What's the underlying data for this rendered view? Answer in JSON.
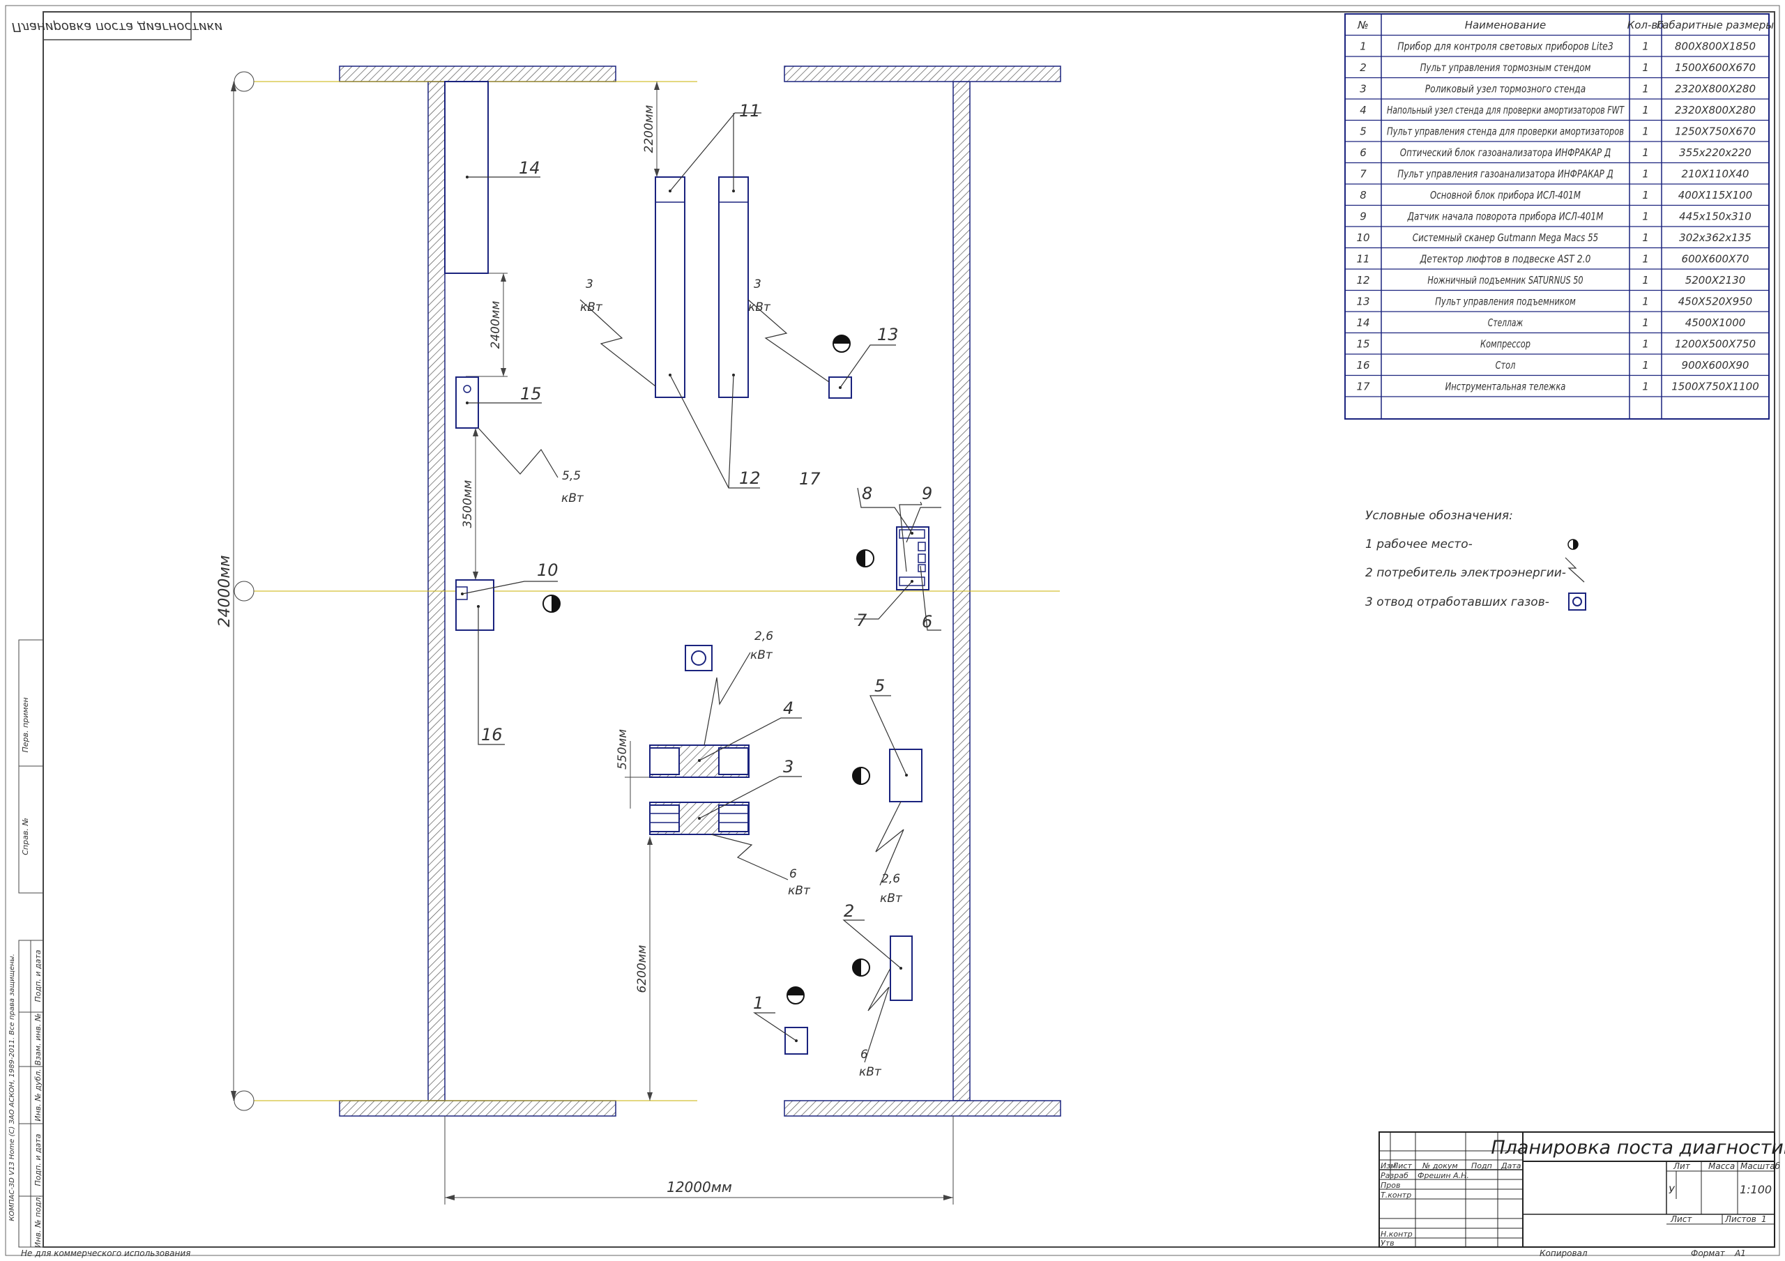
{
  "stamp": {
    "mirrored_title": "Планировка поста диагностики"
  },
  "dimensions": {
    "total_length": "24000мм",
    "width": "12000мм",
    "d_2200": "2200мм",
    "d_2400": "2400мм",
    "d_3500": "3500мм",
    "d_550": "550мм",
    "d_6200": "6200мм"
  },
  "callouts": [
    "1",
    "2",
    "3",
    "4",
    "5",
    "6",
    "7",
    "8",
    "9",
    "10",
    "11",
    "12",
    "13",
    "14",
    "15",
    "16",
    "17"
  ],
  "power_labels": {
    "p1": {
      "value": "3",
      "unit": "кВт"
    },
    "p2": {
      "value": "3",
      "unit": "кВт"
    },
    "p3": {
      "value": "5,5",
      "unit": "кВт"
    },
    "p4": {
      "value": "2,6",
      "unit": "кВт"
    },
    "p5": {
      "value": "6",
      "unit": "кВт"
    },
    "p6": {
      "value": "2,6",
      "unit": "кВт"
    },
    "p7": {
      "value": "6",
      "unit": "кВт"
    }
  },
  "spec_table": {
    "headers": [
      "№",
      "Наименование",
      "Кол-во",
      "Габаритные размеры"
    ],
    "rows": [
      [
        "1",
        "Прибор для контроля световых приборов Lite3",
        "1",
        "800Х800Х1850"
      ],
      [
        "2",
        "Пульт управления тормозным стендом",
        "1",
        "1500Х600Х670"
      ],
      [
        "3",
        "Роликовый узел тормозного стенда",
        "1",
        "2320Х800Х280"
      ],
      [
        "4",
        "Напольный узел стенда для проверки амортизаторов FWT",
        "1",
        "2320Х800Х280"
      ],
      [
        "5",
        "Пульт управления стенда для проверки амортизаторов",
        "1",
        "1250Х750Х670"
      ],
      [
        "6",
        "Оптический блок газоанализатора ИНФРАКАР Д",
        "1",
        "355х220х220"
      ],
      [
        "7",
        "Пульт управления газоанализатора ИНФРАКАР Д",
        "1",
        "210Х110Х40"
      ],
      [
        "8",
        "Основной блок прибора ИСЛ-401М",
        "1",
        "400Х115Х100"
      ],
      [
        "9",
        "Датчик начала поворота прибора ИСЛ-401М",
        "1",
        "445х150х310"
      ],
      [
        "10",
        "Системный сканер Gutmann Mega Macs 55",
        "1",
        "302х362х135"
      ],
      [
        "11",
        "Детектор люфтов в подвеске AST 2.0",
        "1",
        "600Х600Х70"
      ],
      [
        "12",
        "Ножничный подъемник SATURNUS 50",
        "1",
        "5200Х2130"
      ],
      [
        "13",
        "Пульт управления подъемником",
        "1",
        "450Х520Х950"
      ],
      [
        "14",
        "Стеллаж",
        "1",
        "4500Х1000"
      ],
      [
        "15",
        "Компрессор",
        "1",
        "1200Х500Х750"
      ],
      [
        "16",
        "Стол",
        "1",
        "900Х600Х90"
      ],
      [
        "17",
        "Инструментальная тележка",
        "1",
        "1500Х750Х1100"
      ]
    ]
  },
  "legend": {
    "title": "Условные обозначения:",
    "item1": "1 рабочее место-",
    "item2": "2 потребитель электроэнергии-",
    "item3": "3 отвод отработавших газов-"
  },
  "title_block": {
    "drawing_title": "Планировка поста диагностики",
    "col_izm": "Изм",
    "col_list": "Лист",
    "col_doc": "№ докум",
    "col_podp": "Подп",
    "col_data": "Дата",
    "row_razrab": "Разраб",
    "razrab_name": "Фрешин А.Н.",
    "row_prov": "Пров",
    "row_tkontr": "Т.контр",
    "row_nkontr": "Н.контр",
    "row_utv": "Утв",
    "lit_label": "Лит",
    "mass_label": "Масса",
    "scale_label": "Масштаб",
    "lit_value": "У",
    "scale_value": "1:100",
    "sheet_label": "Лист",
    "sheets_label": "Листов",
    "sheets_value": "1"
  },
  "side_strip": {
    "perv_primen": "Перв. примен",
    "sprav": "Справ. №",
    "podp_data_1": "Подп. и дата",
    "vzam_inv": "Взам. инв. №",
    "inv_dubl": "Инв. № дубл.",
    "podp_data_2": "Подп. и дата",
    "inv_podl": "Инв. № подл.",
    "kompas": "КОМПАС-3D V13 Home (С) ЗАО АСКОН, 1989-2011. Все права защищены."
  },
  "footer": {
    "noncommercial": "Не для коммерческого использования",
    "kopiroval": "Копировал",
    "format": "Формат",
    "format_value": "А1"
  }
}
